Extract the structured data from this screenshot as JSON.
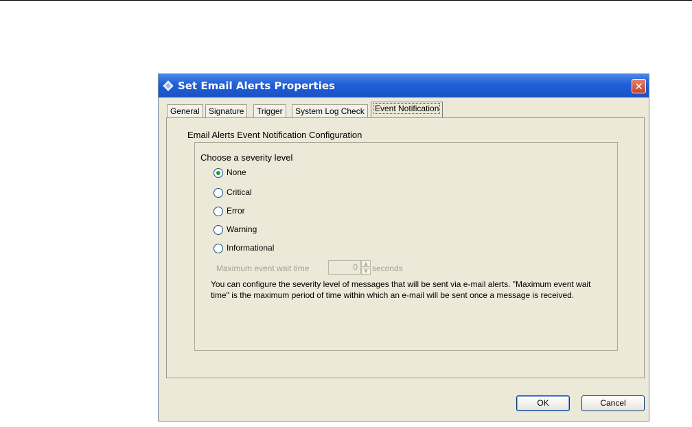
{
  "window": {
    "title": "Set Email Alerts Properties",
    "close_glyph": "✕",
    "icon": "diamond-app-icon"
  },
  "tabs": [
    {
      "label": "General",
      "active": false
    },
    {
      "label": "Signature",
      "active": false
    },
    {
      "label": "Trigger",
      "active": false
    },
    {
      "label": "System Log Check",
      "active": false
    },
    {
      "label": "Event Notification",
      "active": true
    }
  ],
  "panel": {
    "section_title": "Email Alerts Event Notification Configuration",
    "group_title": "Choose a severity level",
    "severity_options": [
      {
        "label": "None",
        "selected": true
      },
      {
        "label": "Critical",
        "selected": false
      },
      {
        "label": "Error",
        "selected": false
      },
      {
        "label": "Warning",
        "selected": false
      },
      {
        "label": "Informational",
        "selected": false
      }
    ],
    "wait_time": {
      "label": "Maximum event wait time",
      "value": "0",
      "unit": "seconds",
      "enabled": false
    },
    "help_text": "You can configure the severity level of messages that will be sent via e-mail alerts. \"Maximum event wait time\" is the maximum period of time within which an e-mail will be sent once a message is received."
  },
  "buttons": {
    "ok": "OK",
    "cancel": "Cancel"
  },
  "colors": {
    "titlebar": "#1f5ed6",
    "dialog_bg": "#ece9d8",
    "radio_selected": "#21a121",
    "disabled_text": "#a09f95"
  }
}
